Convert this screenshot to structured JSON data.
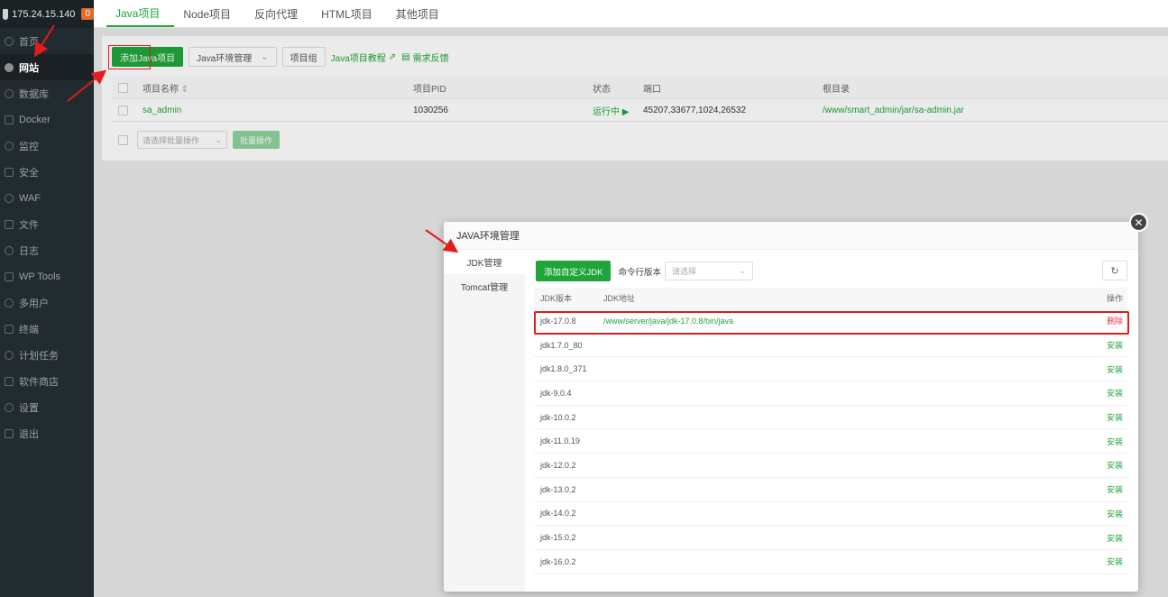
{
  "sidebar": {
    "server_ip": "175.24.15.140",
    "badge": "0",
    "items": [
      {
        "label": "首页",
        "icon": "home-icon"
      },
      {
        "label": "网站",
        "icon": "globe-icon",
        "active": true
      },
      {
        "label": "数据库",
        "icon": "database-icon"
      },
      {
        "label": "Docker",
        "icon": "docker-icon"
      },
      {
        "label": "监控",
        "icon": "monitor-icon"
      },
      {
        "label": "安全",
        "icon": "shield-icon"
      },
      {
        "label": "WAF",
        "icon": "waf-icon"
      },
      {
        "label": "文件",
        "icon": "folder-icon"
      },
      {
        "label": "日志",
        "icon": "log-icon"
      },
      {
        "label": "WP Tools",
        "icon": "wordpress-icon"
      },
      {
        "label": "多用户",
        "icon": "users-icon"
      },
      {
        "label": "终端",
        "icon": "terminal-icon"
      },
      {
        "label": "计划任务",
        "icon": "clock-icon"
      },
      {
        "label": "软件商店",
        "icon": "store-icon"
      },
      {
        "label": "设置",
        "icon": "gear-icon"
      },
      {
        "label": "退出",
        "icon": "logout-icon"
      }
    ]
  },
  "tabs": [
    {
      "label": "Java项目",
      "active": true
    },
    {
      "label": "Node项目"
    },
    {
      "label": "反向代理"
    },
    {
      "label": "HTML项目"
    },
    {
      "label": "其他项目"
    }
  ],
  "toolbar": {
    "add_java": "添加Java项目",
    "env_manage": "Java环境管理",
    "project_group": "项目组",
    "tutorial": "Java项目教程",
    "feedback": "需求反馈"
  },
  "project_table": {
    "headers": {
      "name": "项目名称",
      "pid": "项目PID",
      "state": "状态",
      "port": "端口",
      "root": "根目录"
    },
    "rows": [
      {
        "name": "sa_admin",
        "pid": "1030256",
        "state": "运行中",
        "port": "45207,33677,1024,26532",
        "root": "/www/smart_admin/jar/sa-admin.jar"
      }
    ]
  },
  "batch": {
    "placeholder": "请选择批量操作",
    "button": "批量操作"
  },
  "modal": {
    "title": "JAVA环境管理",
    "side_items": [
      "JDK管理",
      "Tomcat管理"
    ],
    "add_jdk": "添加自定义JDK",
    "cmd_version_label": "命令行版本",
    "cmd_version_placeholder": "请选择",
    "headers": {
      "version": "JDK版本",
      "path": "JDK地址",
      "op": "操作"
    },
    "rows": [
      {
        "version": "jdk-17.0.8",
        "path": "/www/server/java/jdk-17.0.8/bin/java",
        "op": "删除",
        "op_type": "delete"
      },
      {
        "version": "jdk1.7.0_80",
        "path": "",
        "op": "安装"
      },
      {
        "version": "jdk1.8.0_371",
        "path": "",
        "op": "安装"
      },
      {
        "version": "jdk-9.0.4",
        "path": "",
        "op": "安装"
      },
      {
        "version": "jdk-10.0.2",
        "path": "",
        "op": "安装"
      },
      {
        "version": "jdk-11.0.19",
        "path": "",
        "op": "安装"
      },
      {
        "version": "jdk-12.0.2",
        "path": "",
        "op": "安装"
      },
      {
        "version": "jdk-13.0.2",
        "path": "",
        "op": "安装"
      },
      {
        "version": "jdk-14.0.2",
        "path": "",
        "op": "安装"
      },
      {
        "version": "jdk-15.0.2",
        "path": "",
        "op": "安装"
      },
      {
        "version": "jdk-16.0.2",
        "path": "",
        "op": "安装"
      }
    ]
  },
  "colors": {
    "accent": "#20a53a",
    "danger": "#e53935",
    "annotation": "#e21b1b",
    "sidebar": "#222b2f"
  }
}
